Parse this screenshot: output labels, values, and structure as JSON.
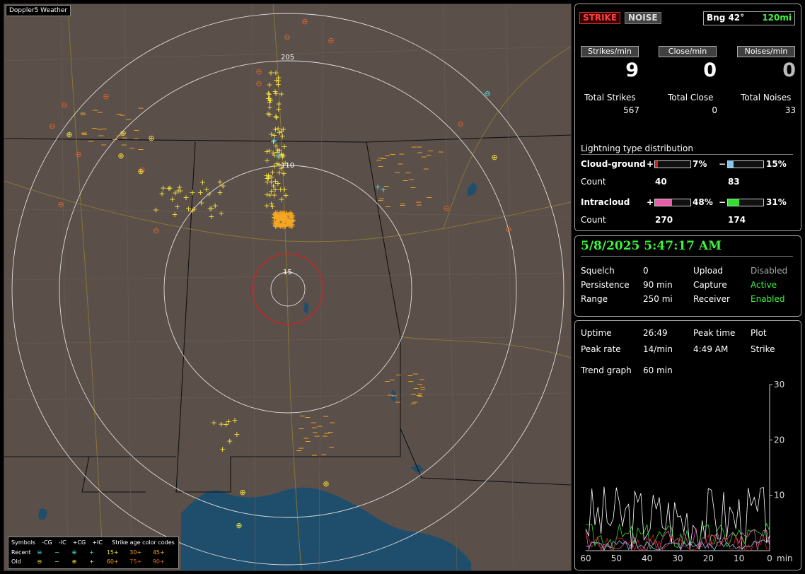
{
  "map": {
    "title": "Doppler5 Weather",
    "ring_labels": [
      "205",
      "110",
      "15"
    ],
    "legend": {
      "symbols_label": "Symbols",
      "columns": [
        "-CG",
        "-IC",
        "+CG",
        "+IC"
      ],
      "age_title": "Strike age color codes",
      "recent_label": "Recent",
      "old_label": "Old",
      "recent_ages": [
        "15+",
        "30+",
        "45+"
      ],
      "old_ages": [
        "60+",
        "75+",
        "90+"
      ]
    }
  },
  "top": {
    "strike_btn": "STRIKE",
    "noise_btn": "NOISE",
    "bearing": "Bng 42°",
    "range": "120mi",
    "rate_labels": [
      "Strikes/min",
      "Close/min",
      "Noises/min"
    ],
    "rate_values": [
      "9",
      "0",
      "0"
    ],
    "total_labels": [
      "Total Strikes",
      "Total Close",
      "Total Noises"
    ],
    "total_values": [
      "567",
      "0",
      "33"
    ],
    "dist_title": "Lightning type distribution",
    "cg_label": "Cloud-ground",
    "ic_label": "Intracloud",
    "count_label": "Count",
    "plus": "+",
    "minus": "−",
    "cg_pos_pct": "7%",
    "cg_neg_pct": "15%",
    "ic_pos_pct": "48%",
    "ic_neg_pct": "31%",
    "cg_pos_count": "40",
    "cg_neg_count": "83",
    "ic_pos_count": "270",
    "ic_neg_count": "174",
    "bars": {
      "cg_pos": 0.07,
      "cg_neg": 0.15,
      "ic_pos": 0.48,
      "ic_neg": 0.31
    }
  },
  "status": {
    "datetime": "5/8/2025 5:47:17 AM",
    "squelch_label": "Squelch",
    "squelch": "0",
    "persistence_label": "Persistence",
    "persistence": "90 min",
    "range_label": "Range",
    "range": "250 mi",
    "upload_label": "Upload",
    "upload": "Disabled",
    "capture_label": "Capture",
    "capture": "Active",
    "receiver_label": "Receiver",
    "receiver": "Enabled"
  },
  "trend": {
    "uptime_label": "Uptime",
    "uptime": "26:49",
    "peak_time_label": "Peak time",
    "peak_time": "4:49 AM",
    "plot_label": "Plot",
    "plot": "Strike",
    "peak_rate_label": "Peak rate",
    "peak_rate": "14/min",
    "graph_label": "Trend graph",
    "graph_window": "60 min",
    "y_ticks": [
      "30",
      "20",
      "10"
    ],
    "x_ticks": [
      "60",
      "50",
      "40",
      "30",
      "20",
      "10",
      "0"
    ],
    "x_unit": "min"
  },
  "colors": {
    "recent": "#3fe6f0",
    "old_yellow": "#f5e23c",
    "mid_orange": "#f5a623",
    "old_orange": "#e0652a",
    "map_bg": "#5b4f4a",
    "water": "#1f4e6c",
    "range_red": "#d91f1f"
  }
}
